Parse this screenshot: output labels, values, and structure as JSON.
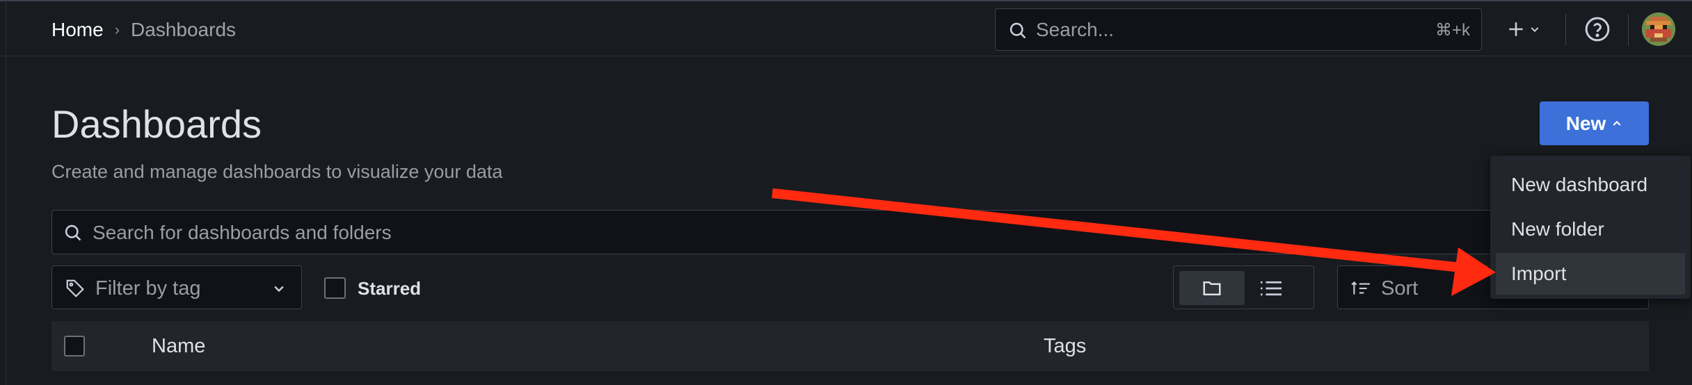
{
  "breadcrumb": {
    "home": "Home",
    "separator": "›",
    "current": "Dashboards"
  },
  "topbar": {
    "search_placeholder": "Search...",
    "search_shortcut": "⌘+k",
    "add_icon": "plus-icon",
    "help_icon": "help-circle-icon"
  },
  "page": {
    "title": "Dashboards",
    "subtitle": "Create and manage dashboards to visualize your data"
  },
  "new_button": {
    "label": "New",
    "color": "#3d71d9"
  },
  "new_menu": {
    "items": [
      {
        "label": "New dashboard"
      },
      {
        "label": "New folder"
      },
      {
        "label": "Import"
      }
    ]
  },
  "search": {
    "placeholder": "Search for dashboards and folders"
  },
  "filters": {
    "tag_placeholder": "Filter by tag",
    "starred_label": "Starred",
    "sort_placeholder": "Sort",
    "view_modes": [
      "folder-view-icon",
      "list-view-icon"
    ]
  },
  "table": {
    "columns": [
      "Name",
      "Tags"
    ]
  },
  "annotation": {
    "arrow_color": "#ff2a10",
    "points_to": "Import"
  }
}
